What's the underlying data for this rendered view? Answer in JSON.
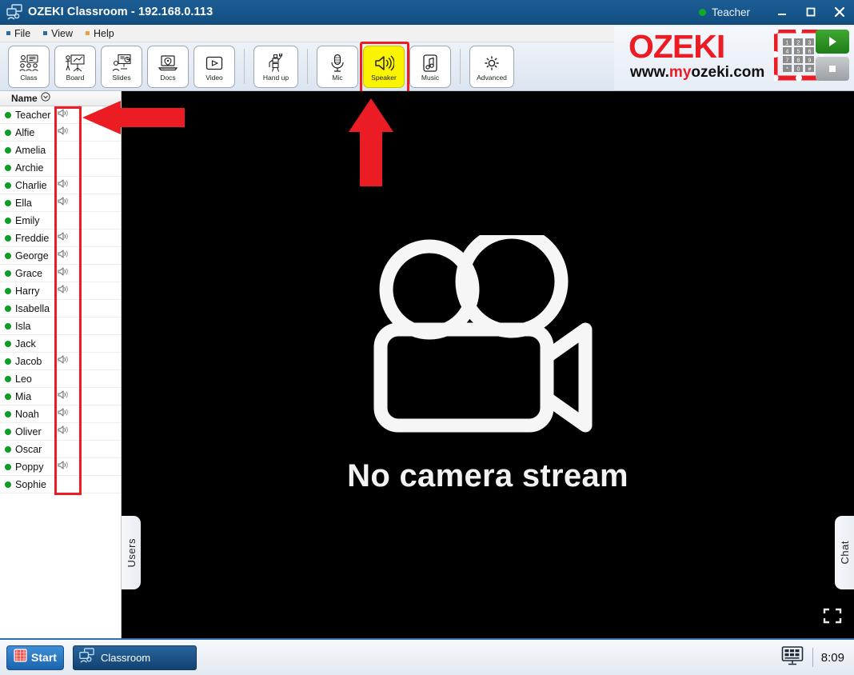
{
  "window": {
    "app_icon": "classroom-icon",
    "title": "OZEKI Classroom",
    "separator": "-",
    "host": "192.168.0.113",
    "user_status_label": "Teacher",
    "user_status_color": "#0faa27",
    "minimize_label": "Minimize",
    "maximize_label": "Maximize",
    "close_label": "Close"
  },
  "menubar": {
    "items": [
      {
        "label": "File",
        "bullet_color": "#2b6ca3"
      },
      {
        "label": "View",
        "bullet_color": "#2b6ca3"
      },
      {
        "label": "Help",
        "bullet_color": "#e8a33d"
      }
    ]
  },
  "toolbar": {
    "groups": [
      {
        "buttons": [
          {
            "label": "Class",
            "icon": "class-icon",
            "active": false
          },
          {
            "label": "Board",
            "icon": "board-icon",
            "active": false
          },
          {
            "label": "Slides",
            "icon": "slides-icon",
            "active": false
          },
          {
            "label": "Docs",
            "icon": "docs-icon",
            "active": false
          },
          {
            "label": "Video",
            "icon": "video-icon",
            "active": false
          }
        ]
      },
      {
        "buttons": [
          {
            "label": "Hand up",
            "icon": "hand-up-icon",
            "active": false
          }
        ]
      },
      {
        "buttons": [
          {
            "label": "Mic",
            "icon": "mic-icon",
            "active": false
          },
          {
            "label": "Speaker",
            "icon": "speaker-icon",
            "active": true
          },
          {
            "label": "Music",
            "icon": "music-icon",
            "active": false
          }
        ]
      },
      {
        "buttons": [
          {
            "label": "Advanced",
            "icon": "gear-icon",
            "active": false
          }
        ]
      }
    ],
    "active_button_bg": "#fbf400",
    "highlight_color": "#ec1c24"
  },
  "logo": {
    "brand": "OZEKI",
    "brand_color": "#ec1c24",
    "url_prefix": "www.",
    "url_highlight": "my",
    "url_suffix": "ozeki.com",
    "keypad_keys": [
      "1",
      "2",
      "3",
      "4",
      "5",
      "6",
      "7",
      "8",
      "9",
      "*",
      "0",
      "#"
    ],
    "play_button": "play-icon",
    "stop_button": "stop-icon"
  },
  "user_list": {
    "column_header": "Name",
    "sort_icon": "chevron-down-circle-icon",
    "status_color": "#0b9e23",
    "speaker_icon": "speaker-small-icon",
    "rows": [
      {
        "name": "Teacher",
        "online": true,
        "speaker": true
      },
      {
        "name": "Alfie",
        "online": true,
        "speaker": true
      },
      {
        "name": "Amelia",
        "online": true,
        "speaker": false
      },
      {
        "name": "Archie",
        "online": true,
        "speaker": false
      },
      {
        "name": "Charlie",
        "online": true,
        "speaker": true
      },
      {
        "name": "Ella",
        "online": true,
        "speaker": true
      },
      {
        "name": "Emily",
        "online": true,
        "speaker": false
      },
      {
        "name": "Freddie",
        "online": true,
        "speaker": true
      },
      {
        "name": "George",
        "online": true,
        "speaker": true
      },
      {
        "name": "Grace",
        "online": true,
        "speaker": true
      },
      {
        "name": "Harry",
        "online": true,
        "speaker": true
      },
      {
        "name": "Isabella",
        "online": true,
        "speaker": false
      },
      {
        "name": "Isla",
        "online": true,
        "speaker": false
      },
      {
        "name": "Jack",
        "online": true,
        "speaker": false
      },
      {
        "name": "Jacob",
        "online": true,
        "speaker": true
      },
      {
        "name": "Leo",
        "online": true,
        "speaker": false
      },
      {
        "name": "Mia",
        "online": true,
        "speaker": true
      },
      {
        "name": "Noah",
        "online": true,
        "speaker": true
      },
      {
        "name": "Oliver",
        "online": true,
        "speaker": true
      },
      {
        "name": "Oscar",
        "online": true,
        "speaker": false
      },
      {
        "name": "Poppy",
        "online": true,
        "speaker": true
      },
      {
        "name": "Sophie",
        "online": true,
        "speaker": false
      }
    ]
  },
  "stage": {
    "placeholder_text": "No camera stream",
    "camera_icon": "movie-camera-icon",
    "left_tab_label": "Users",
    "right_tab_label": "Chat",
    "fullscreen_icon": "fullscreen-icon"
  },
  "annotations": {
    "arrow_color": "#ec1c24",
    "left_arrow": "arrow-left-annotation",
    "up_arrow": "arrow-up-annotation",
    "column_box": "speaker-column-annotation"
  },
  "taskbar": {
    "start_label": "Start",
    "start_icon": "windows-start-icon",
    "task_label": "Classroom",
    "task_icon": "classroom-icon",
    "tray_icon": "display-settings-icon",
    "clock": "8:09"
  }
}
